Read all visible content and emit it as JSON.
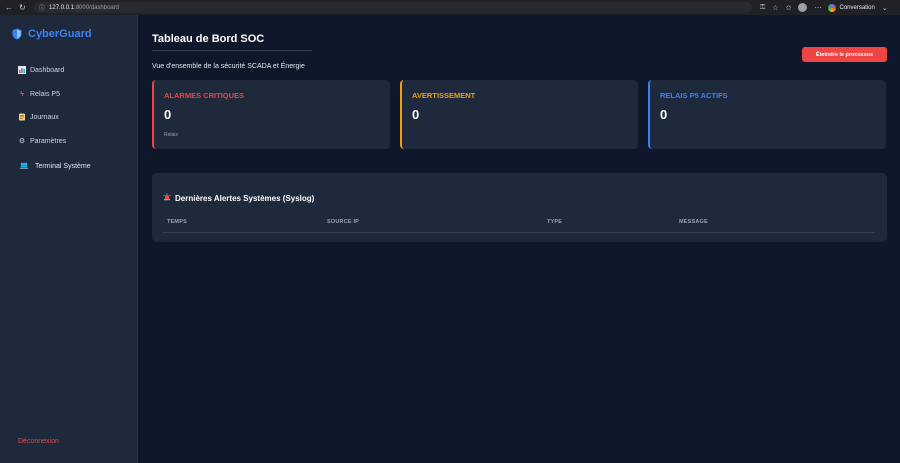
{
  "browser": {
    "url_host": "127.0.0.1",
    "url_path": ":8000/dashboard",
    "profile_label": "Conversation"
  },
  "sidebar": {
    "brand": "CyberGuard",
    "items": [
      {
        "icon": "chart-icon",
        "label": "Dashboard"
      },
      {
        "icon": "lightning-icon",
        "label": "Relais P5"
      },
      {
        "icon": "scroll-icon",
        "label": "Journaux"
      },
      {
        "icon": "gear-icon",
        "label": "Paramètres"
      },
      {
        "icon": "laptop-icon",
        "label": "Terminal Système"
      }
    ],
    "logout_label": "Déconnexion"
  },
  "main": {
    "title": "Tableau de Bord SOC",
    "subtitle": "Vue d'ensemble de la sécurité SCADA et Énergie",
    "stop_button": "Éteindre le processus",
    "cards": [
      {
        "title": "ALARMES CRITIQUES",
        "value": "0",
        "sub": "Relais"
      },
      {
        "title": "AVERTISSEMENT",
        "value": "0"
      },
      {
        "title": "RELAIS P5 ACTIFS",
        "value": "0"
      }
    ],
    "alerts": {
      "title": "Dernières Alertes Systèmes (Syslog)",
      "columns": [
        "TEMPS",
        "SOURCE IP",
        "TYPE",
        "MESSAGE"
      ]
    }
  },
  "colors": {
    "background": "#0f172a",
    "panel": "#1e293b",
    "brand": "#3b82f6",
    "critical": "#ef4444",
    "warning": "#f59e0b",
    "info": "#3b82f6"
  }
}
